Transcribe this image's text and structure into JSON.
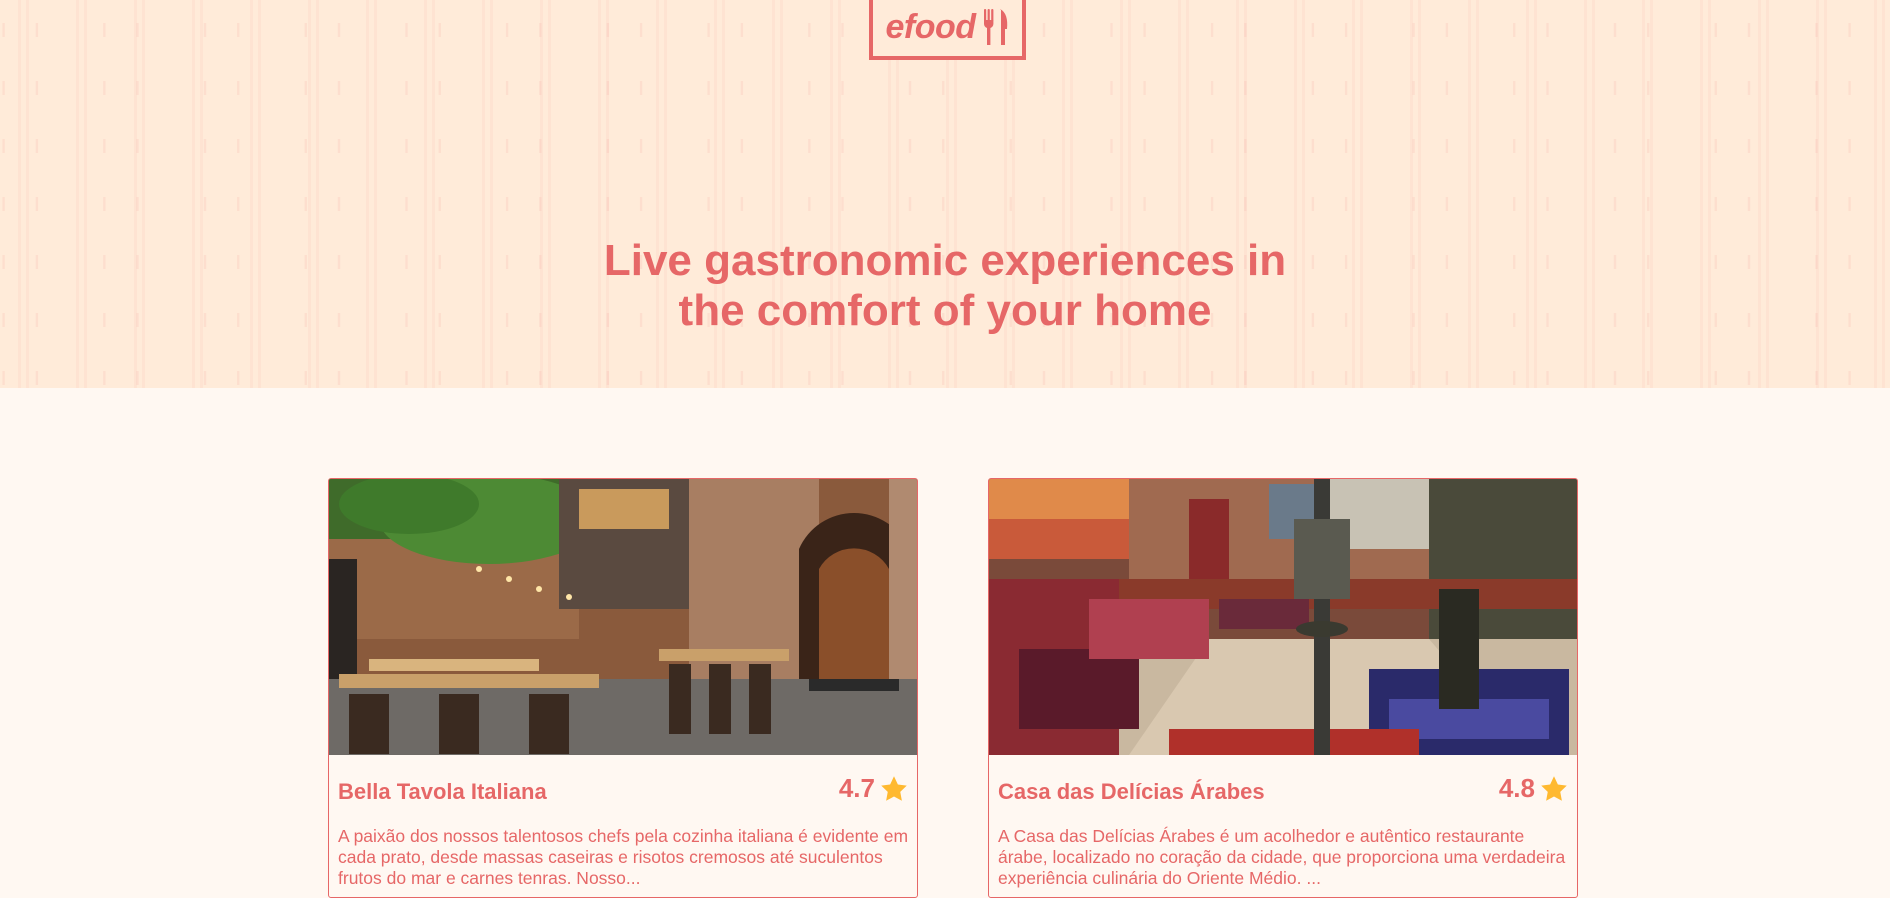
{
  "header": {
    "logo_text": "efood",
    "hero_title_line1": "Live gastronomic experiences in",
    "hero_title_line2": "the comfort of your home"
  },
  "restaurants": [
    {
      "name": "Bella Tavola Italiana",
      "rating": "4.7",
      "description": "A paixão dos nossos talentosos chefs pela cozinha italiana é evidente em cada prato, desde massas caseiras e risotos cremosos até suculentos frutos do mar e carnes tenras. Nosso..."
    },
    {
      "name": "Casa das Delícias Árabes",
      "rating": "4.8",
      "description": "A Casa das Delícias Árabes é um acolhedor e autêntico restaurante árabe, localizado no coração da cidade, que proporciona uma verdadeira experiência culinária do Oriente Médio. ..."
    }
  ],
  "colors": {
    "primary": "#E66767",
    "hero_bg": "#FFEBD9",
    "page_bg": "#FFF8F2",
    "star": "#FFB930"
  },
  "icons": [
    "fork-knife-icon",
    "star-icon"
  ]
}
